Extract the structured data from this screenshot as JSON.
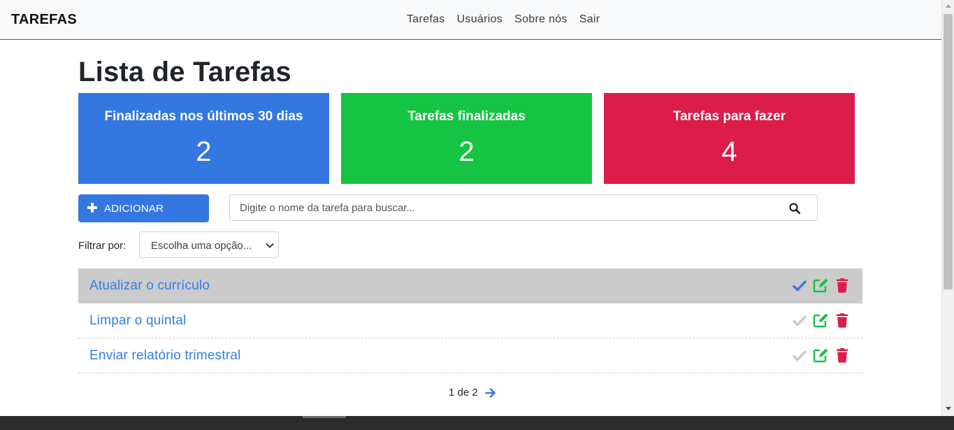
{
  "navbar": {
    "brand": "TAREFAS",
    "links": [
      "Tarefas",
      "Usuários",
      "Sobre nós",
      "Sair"
    ]
  },
  "page_title": "Lista de Tarefas",
  "cards": [
    {
      "title": "Finalizadas nos últimos 30 dias",
      "value": "2",
      "color": "#3577e0"
    },
    {
      "title": "Tarefas finalizadas",
      "value": "2",
      "color": "#16c443"
    },
    {
      "title": "Tarefas para fazer",
      "value": "4",
      "color": "#dc1c49"
    }
  ],
  "toolbar": {
    "add_label": "ADICIONAR",
    "search_placeholder": "Digite o nome da tarefa para buscar..."
  },
  "filter": {
    "label": "Filtrar por:",
    "selected": "Escolha uma opção..."
  },
  "tasks": [
    {
      "name": "Atualizar o currículo",
      "completed": true,
      "highlighted": true
    },
    {
      "name": "Limpar o quintal",
      "completed": false,
      "highlighted": false
    },
    {
      "name": "Enviar relatório trimestral",
      "completed": false,
      "highlighted": false
    }
  ],
  "pagination": {
    "text": "1 de 2"
  },
  "colors": {
    "primary": "#3577e0",
    "success": "#16c443",
    "danger": "#dc1c49",
    "check_done": "#3577e0",
    "check_pending": "#c6c6c6",
    "link": "#2f7ee8"
  },
  "icons": {
    "add": "plus-icon",
    "search": "search-icon",
    "select": "chevron-down-icon",
    "complete": "check-icon",
    "edit": "edit-icon",
    "delete": "trash-icon",
    "next": "arrow-right-icon"
  }
}
